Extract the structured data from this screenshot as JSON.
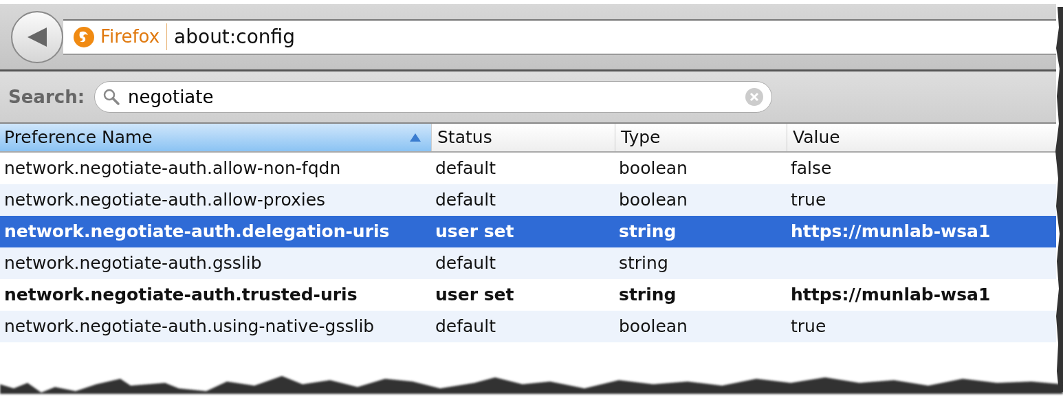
{
  "toolbar": {
    "identity_label": "Firefox",
    "url": "about:config"
  },
  "search": {
    "label": "Search:",
    "value": "negotiate"
  },
  "table": {
    "columns": [
      {
        "label": "Preference Name",
        "sorted": true
      },
      {
        "label": "Status",
        "sorted": false
      },
      {
        "label": "Type",
        "sorted": false
      },
      {
        "label": "Value",
        "sorted": false
      }
    ],
    "rows": [
      {
        "name": "network.negotiate-auth.allow-non-fqdn",
        "status": "default",
        "type": "boolean",
        "value": "false",
        "modified": false,
        "selected": false
      },
      {
        "name": "network.negotiate-auth.allow-proxies",
        "status": "default",
        "type": "boolean",
        "value": "true",
        "modified": false,
        "selected": false
      },
      {
        "name": "network.negotiate-auth.delegation-uris",
        "status": "user set",
        "type": "string",
        "value": "https://munlab-wsa1",
        "modified": true,
        "selected": true
      },
      {
        "name": "network.negotiate-auth.gsslib",
        "status": "default",
        "type": "string",
        "modified": false,
        "selected": false
      },
      {
        "name": "network.negotiate-auth.trusted-uris",
        "status": "user set",
        "type": "string",
        "value": "https://munlab-wsa1",
        "modified": true,
        "selected": false
      },
      {
        "name": "network.negotiate-auth.using-native-gsslib",
        "status": "default",
        "type": "boolean",
        "value": "true",
        "modified": false,
        "selected": false
      }
    ]
  }
}
